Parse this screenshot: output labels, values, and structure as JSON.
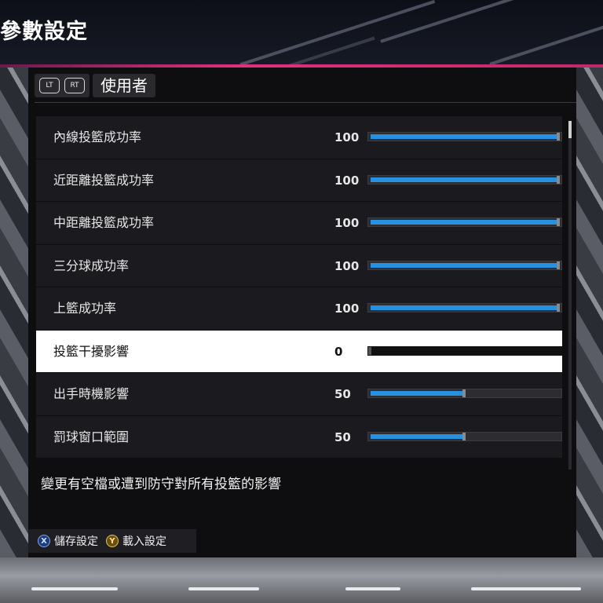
{
  "header": {
    "title": "參數設定"
  },
  "tabs": {
    "left_bumper": "LT",
    "right_bumper": "RT",
    "active_label": "使用者"
  },
  "settings": [
    {
      "label": "內線投籃成功率",
      "value": "100",
      "level": 1.0,
      "selected": false
    },
    {
      "label": "近距離投籃成功率",
      "value": "100",
      "level": 1.0,
      "selected": false
    },
    {
      "label": "中距離投籃成功率",
      "value": "100",
      "level": 1.0,
      "selected": false
    },
    {
      "label": "三分球成功率",
      "value": "100",
      "level": 1.0,
      "selected": false
    },
    {
      "label": "上籃成功率",
      "value": "100",
      "level": 1.0,
      "selected": false
    },
    {
      "label": "投籃干擾影響",
      "value": "0",
      "level": 0.0,
      "selected": true
    },
    {
      "label": "出手時機影響",
      "value": "50",
      "level": 0.5,
      "selected": false
    },
    {
      "label": "罰球窗口範圍",
      "value": "50",
      "level": 0.5,
      "selected": false
    }
  ],
  "description": "變更有空檔或遭到防守對所有投籃的影響",
  "footer": {
    "save": {
      "glyph": "X",
      "label": "儲存設定"
    },
    "load": {
      "glyph": "Y",
      "label": "載入設定"
    }
  },
  "colors": {
    "accent": "#2591e0",
    "selected_row": "#ffffff",
    "header_line": "#e0307e"
  },
  "icons": [
    "lt-bumper-icon",
    "rt-bumper-icon",
    "x-button-icon",
    "y-button-icon"
  ]
}
